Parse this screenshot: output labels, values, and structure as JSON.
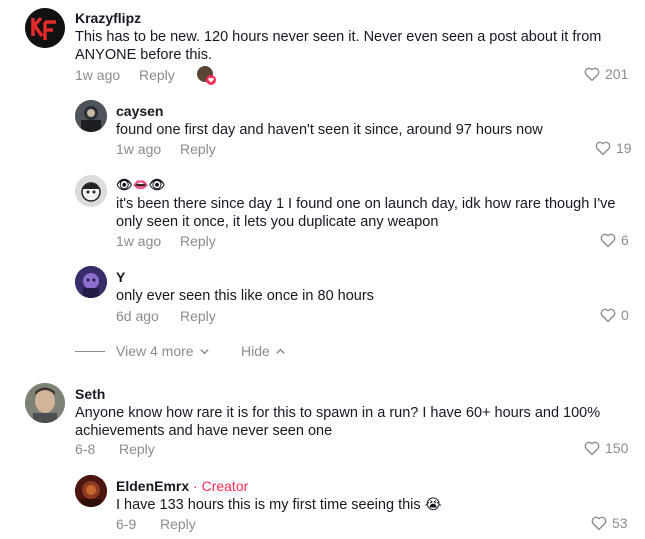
{
  "comments": [
    {
      "username": "Krazyflipz",
      "text": "This has to be new. 120 hours never seen it. Never even seen a post about it from ANYONE before this.",
      "time": "1w ago",
      "reply_label": "Reply",
      "likes": "201"
    },
    {
      "username": "caysen",
      "text": "found one first day and haven't seen it since, around 97 hours now",
      "time": "1w ago",
      "reply_label": "Reply",
      "likes": "19"
    },
    {
      "username": "👁👄👁",
      "text": "it's been there since day 1 I found one on launch day, idk how rare though I've only seen it once, it lets you duplicate any weapon",
      "time": "1w ago",
      "reply_label": "Reply",
      "likes": "6"
    },
    {
      "username": "Y",
      "text": "only ever seen this like once in 80 hours",
      "time": "6d ago",
      "reply_label": "Reply",
      "likes": "0"
    },
    {
      "username": "Seth",
      "text": "Anyone know how rare it is for this to spawn in a run? I have 60+ hours and 100% achievements and have never seen one",
      "time": "6-8",
      "reply_label": "Reply",
      "likes": "150"
    },
    {
      "username": "EldenEmrx",
      "creator_badge": "· Creator",
      "text": "I have 133 hours this is my first time seeing this 😭",
      "time": "6-9",
      "reply_label": "Reply",
      "likes": "53"
    }
  ],
  "thread_controls": {
    "view_more": "View 4 more",
    "hide": "Hide"
  },
  "colors": {
    "meta_gray": "#8a8b91",
    "creator_red": "#fe2c55",
    "text": "#161823"
  },
  "icons": {
    "like": "heart-outline-icon",
    "expand": "chevron-down-icon",
    "collapse": "chevron-up-icon"
  }
}
